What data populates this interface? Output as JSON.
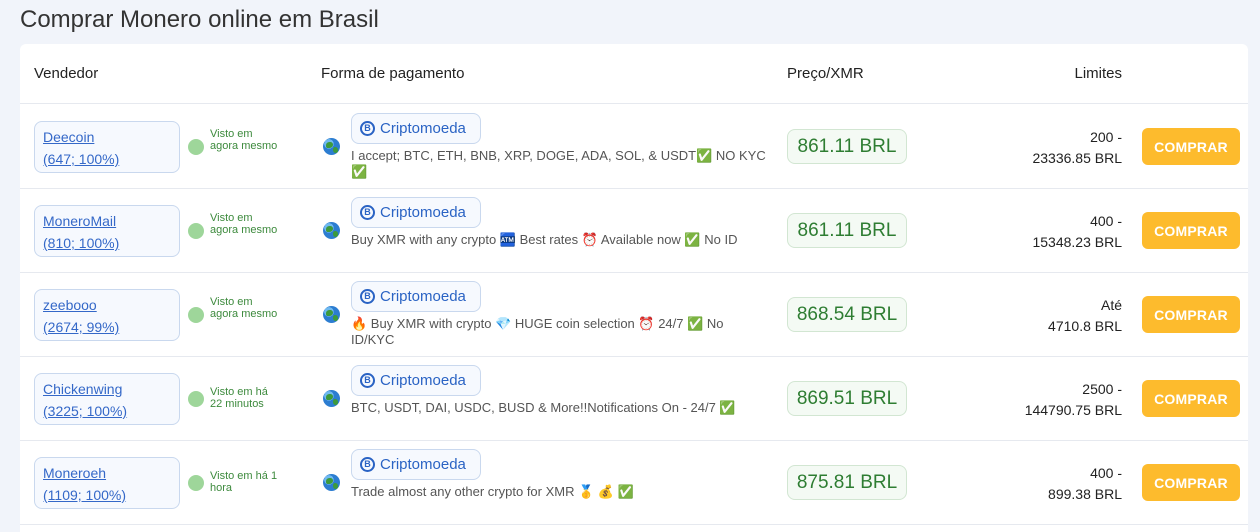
{
  "page": {
    "title": "Comprar Monero online em Brasil"
  },
  "table": {
    "headers": {
      "vendor": "Vendedor",
      "payment": "Forma de pagamento",
      "price": "Preço/XMR",
      "limits": "Limites"
    },
    "rows": [
      {
        "vendor_name": "Deecoin",
        "vendor_stats": "(647; 100%)",
        "status": "Visto em agora mesmo",
        "payment_method": "Criptomoeda",
        "description": "I accept; BTC, ETH, BNB, XRP, DOGE, ADA, SOL, & USDT✅ NO KYC ✅",
        "price": "861.11 BRL",
        "limit_line1": "200 -",
        "limit_line2": "23336.85 BRL",
        "button": "COMPRAR"
      },
      {
        "vendor_name": "MoneroMail",
        "vendor_stats": "(810; 100%)",
        "status": "Visto em agora mesmo",
        "payment_method": "Criptomoeda",
        "description": "Buy XMR with any crypto 🏧 Best rates ⏰ Available now ✅ No ID",
        "price": "861.11 BRL",
        "limit_line1": "400 -",
        "limit_line2": "15348.23 BRL",
        "button": "COMPRAR"
      },
      {
        "vendor_name": "zeebooo",
        "vendor_stats": "(2674; 99%)",
        "status": "Visto em agora mesmo",
        "payment_method": "Criptomoeda",
        "description": "🔥 Buy XMR with crypto 💎 HUGE coin selection ⏰ 24/7 ✅ No ID/KYC",
        "price": "868.54 BRL",
        "limit_line1": "Até",
        "limit_line2": "4710.8 BRL",
        "button": "COMPRAR"
      },
      {
        "vendor_name": "Chickenwing",
        "vendor_stats": "(3225; 100%)",
        "status": "Visto em há 22 minutos",
        "payment_method": "Criptomoeda",
        "description": "BTC, USDT, DAI, USDC, BUSD & More!!Notifications On - 24/7 ✅",
        "price": "869.51 BRL",
        "limit_line1": "2500 -",
        "limit_line2": "144790.75 BRL",
        "button": "COMPRAR"
      },
      {
        "vendor_name": "Moneroeh",
        "vendor_stats": "(1109; 100%)",
        "status": "Visto em há 1 hora",
        "payment_method": "Criptomoeda",
        "description": "Trade almost any other crypto for XMR 🥇 💰 ✅",
        "price": "875.81 BRL",
        "limit_line1": "400 -",
        "limit_line2": "899.38 BRL",
        "button": "COMPRAR"
      }
    ]
  },
  "icons": {
    "status": "online-status-dot-icon",
    "globe": "globe-icon",
    "coin": "bitcoin-coin-icon"
  },
  "colors": {
    "accent": "#fdbb2d",
    "link": "#3468c8",
    "price": "#2e7d32",
    "status": "#3d8a3d"
  }
}
